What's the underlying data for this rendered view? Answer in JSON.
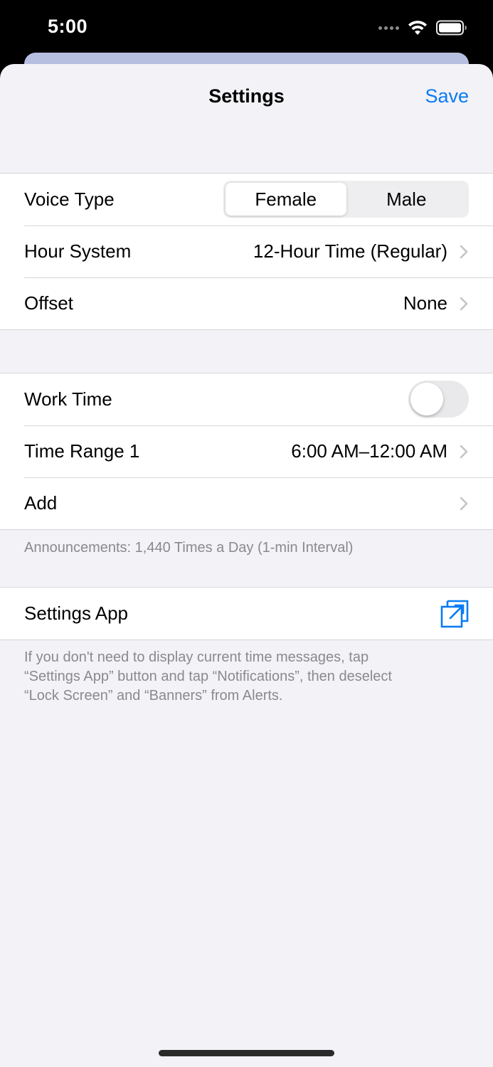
{
  "status_bar": {
    "time": "5:00"
  },
  "nav": {
    "title": "Settings",
    "save_label": "Save"
  },
  "voice_type": {
    "label": "Voice Type",
    "options": [
      "Female",
      "Male"
    ],
    "selected": "Female"
  },
  "hour_system": {
    "label": "Hour System",
    "value": "12-Hour Time (Regular)"
  },
  "offset": {
    "label": "Offset",
    "value": "None"
  },
  "work_time": {
    "label": "Work Time",
    "enabled": false
  },
  "time_range": {
    "label": "Time Range 1",
    "value": "6:00 AM–12:00 AM"
  },
  "add": {
    "label": "Add"
  },
  "announcements_note": "Announcements: 1,440 Times a Day (1-min Interval)",
  "settings_app": {
    "label": "Settings App",
    "icon": "external-link-icon"
  },
  "settings_note_lines": [
    "If you don't need to display current time messages, tap",
    "“Settings App” button and tap “Notifications”, then deselect",
    "“Lock Screen” and “Banners” from Alerts."
  ],
  "colors": {
    "accent": "#0a7bf5",
    "background": "#f2f2f7",
    "secondary_text": "#8a8a8e"
  }
}
